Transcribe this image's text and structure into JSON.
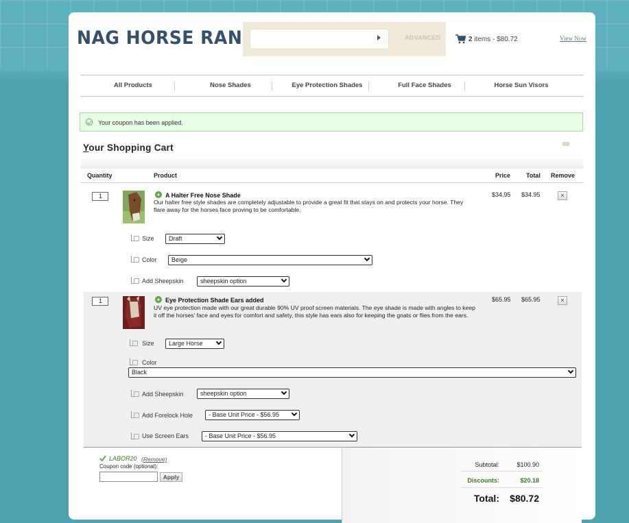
{
  "site": {
    "logo": "NAG HORSE RANCH"
  },
  "search": {
    "placeholder": "",
    "advanced_label": "ADVANCED"
  },
  "header_cart": {
    "count": "2",
    "summary": "items - $80.72",
    "view_now": "View Now"
  },
  "nav": {
    "items": [
      {
        "label": "All Products"
      },
      {
        "label": "Nose Shades"
      },
      {
        "label": "Eye Protection Shades"
      },
      {
        "label": "Full Face Shades"
      },
      {
        "label": "Horse Sun Visors"
      }
    ]
  },
  "notice": {
    "text": "Your coupon has been applied."
  },
  "cart": {
    "title_first": "Y",
    "title_rest": "our Shopping Cart",
    "columns": {
      "quantity": "Quantity",
      "product": "Product",
      "price": "Price",
      "total": "Total",
      "remove": "Remove"
    },
    "items": [
      {
        "qty": "1",
        "name": "A Halter Free Nose Shade",
        "desc": "Our halter free style shades are completely adjustable to provide a great fit that stays on and protects your horse. They flare away for the horses face proving to be comfortable.",
        "price": "$34.95",
        "total": "$34.95",
        "remove": "×",
        "options": [
          {
            "label": "Size",
            "value": "Draft"
          },
          {
            "label": "Color",
            "value": "Beige"
          },
          {
            "label": "Add Sheepskin",
            "value": "sheepskin option"
          }
        ]
      },
      {
        "qty": "1",
        "name": "Eye Protection Shade Ears added",
        "desc": "UV eye protection made with our great durable 90% UV proof screen materials. The eye shade is made with angles to keep it off the horses' face and eyes for comfort and safety, this style has ears also for keeping the gnats or flies from the ears.",
        "price": "$65.95",
        "total": "$65.95",
        "remove": "×",
        "options": [
          {
            "label": "Size",
            "value": "Large Horse"
          },
          {
            "label": "Color",
            "value": "Black"
          },
          {
            "label": "Add Sheepskin",
            "value": "sheepskin option"
          },
          {
            "label": "Add Forelock Hole",
            "value": "- Base Unit Price - $56.95"
          },
          {
            "label": "Use Screen Ears",
            "value": "- Base Unit Price - $56.95"
          }
        ]
      }
    ]
  },
  "coupon": {
    "code": "LABOR20",
    "remove": "(Remove)",
    "label": "Coupon code (optional):",
    "input_value": "",
    "apply": "Apply"
  },
  "totals": {
    "subtotal_label": "Subtotal:",
    "subtotal": "$100.90",
    "discounts_label": "Discounts:",
    "discounts": "$20.18",
    "total_label": "Total:",
    "total": "$80.72"
  },
  "colors": {
    "page_bg": "#4fa2b2",
    "logo": "#35506b",
    "discount_green": "#3e7a2a",
    "notice_bg": "#e6fde6"
  }
}
